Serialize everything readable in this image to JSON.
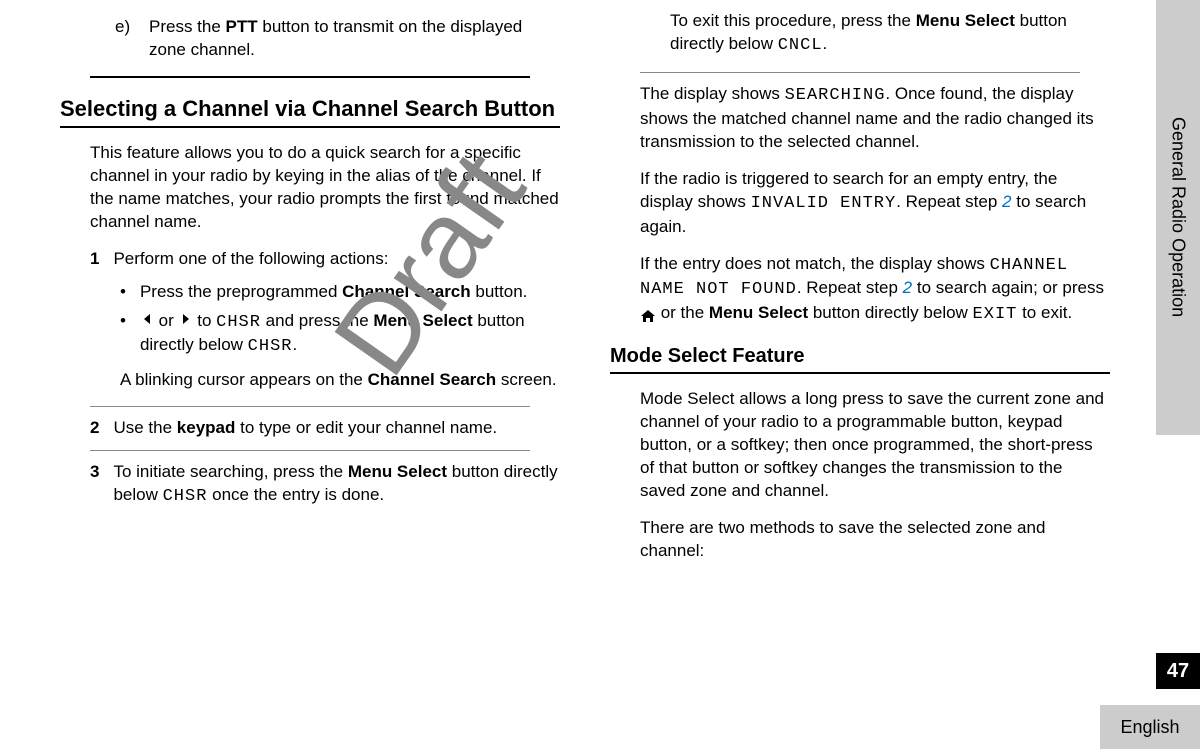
{
  "watermark": "Draft",
  "sidebar": {
    "section": "General Radio Operation",
    "page_number": "47",
    "language": "English"
  },
  "col1": {
    "step_e_marker": "e)",
    "step_e_text_pre": "Press the ",
    "step_e_bold": "PTT",
    "step_e_text_post": " button to transmit on the displayed zone channel.",
    "heading1": "Selecting a Channel via Channel Search Button",
    "intro": "This feature allows you to do a quick search for a specific channel in your radio by keying in the alias of the channel. If the name matches, your radio prompts the first found matched channel name.",
    "s1_num": "1",
    "s1_text": "Perform one of the following actions:",
    "s1_b1_pre": "Press the preprogrammed ",
    "s1_b1_bold": "Channel Search",
    "s1_b1_post": " button.",
    "s1_b2_mid1": " or ",
    "s1_b2_mid2": " to ",
    "s1_b2_mono1": "CHSR",
    "s1_b2_mid3": " and press the ",
    "s1_b2_bold": "Menu Select",
    "s1_b2_mid4": " button directly below ",
    "s1_b2_mono2": "CHSR",
    "s1_b2_post": ".",
    "s1_result_pre": "A blinking cursor appears on the ",
    "s1_result_bold": "Channel Search",
    "s1_result_post": " screen.",
    "s2_num": "2",
    "s2_pre": "Use the ",
    "s2_bold": "keypad",
    "s2_post": " to type or edit your channel name.",
    "s3_num": "3",
    "s3_pre": "To initiate searching, press the ",
    "s3_bold": "Menu Select",
    "s3_mid": " button directly below ",
    "s3_mono": "CHSR",
    "s3_post": " once the entry is done."
  },
  "col2": {
    "exit_pre": "To exit this procedure, press the ",
    "exit_bold": "Menu Select",
    "exit_mid": " button directly below ",
    "exit_mono": "CNCL",
    "exit_post": ".",
    "search_pre": "The display shows ",
    "search_mono": "SEARCHING",
    "search_post": ". Once found, the display shows the matched channel name and the radio changed its transmission to the selected channel.",
    "invalid_pre": "If the radio is triggered to search for an empty entry, the display shows ",
    "invalid_mono": "INVALID ENTRY",
    "invalid_mid": ". Repeat step ",
    "invalid_link": "2",
    "invalid_post": " to search again.",
    "notfound_pre": "If the entry does not match, the display shows ",
    "notfound_mono": "CHANNEL NAME NOT FOUND",
    "notfound_mid1": ". Repeat step ",
    "notfound_link": "2",
    "notfound_mid2": " to search again; or press ",
    "notfound_mid3": " or the ",
    "notfound_bold": "Menu Select",
    "notfound_mid4": " button directly below ",
    "notfound_mono2": "EXIT",
    "notfound_post": " to exit.",
    "heading2": "Mode Select Feature",
    "mode_para": "Mode Select allows a long press to save the current zone and channel of your radio to a programmable button, keypad button, or a softkey; then once programmed, the short-press of that button or softkey changes the transmission to the saved zone and channel.",
    "mode_two": "There are two methods to save the selected zone and channel:"
  }
}
